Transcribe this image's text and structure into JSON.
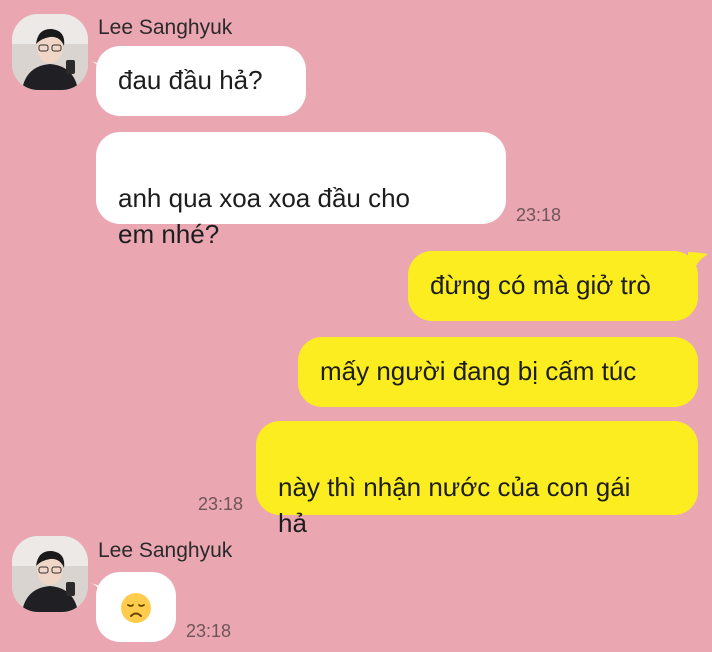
{
  "messages": [
    {
      "sender": "Lee Sanghyuk",
      "bubbles": [
        "đau đầu hả?",
        "anh qua xoa xoa đầu cho\nem nhé?"
      ],
      "time": "23:18"
    },
    {
      "sender": "me",
      "bubbles": [
        "đừng có mà giở trò",
        "mấy người đang bị cấm túc",
        "này thì nhận nước của con gái\nhả"
      ],
      "time": "23:18"
    },
    {
      "sender": "Lee Sanghyuk",
      "bubbles": [
        "disappointed-face-emoji"
      ],
      "time": "23:18"
    }
  ],
  "colors": {
    "background": "#eaa7b2",
    "incoming_bubble": "#ffffff",
    "outgoing_bubble": "#fbed1f"
  }
}
